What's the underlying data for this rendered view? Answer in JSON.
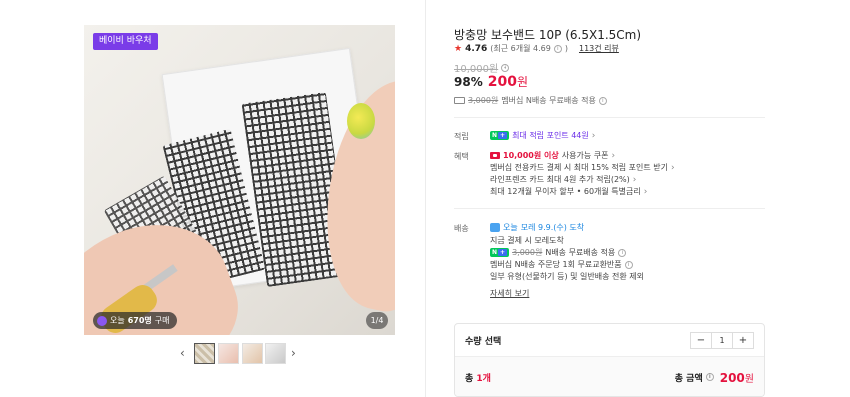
{
  "gallery": {
    "badge_top": "베이비 바우처",
    "badge_today_prefix": "오늘",
    "badge_today_count": "670명",
    "badge_today_suffix": "구매",
    "page_indicator": "1/4",
    "prev_icon": "chevron-left-icon",
    "next_icon": "chevron-right-icon",
    "thumbnail_count": 4
  },
  "product": {
    "title": "방충망 보수밴드 10P (6.5X1.5Cm)",
    "rating": "4.76",
    "rating_detail": "(최근 6개월 4.69",
    "review_link": "113건 리뷰",
    "original_price": "10,000원",
    "discount": "98%",
    "sale_price": "200",
    "currency": "원",
    "shipping_strike": "3,000원",
    "shipping_text": "멤버십 N배송 무료배송 적용"
  },
  "benefits": {
    "points_label": "적립",
    "points_text": "최대 적립 포인트 44원",
    "perks_label": "혜택",
    "perks": [
      {
        "highlight": "10,000원 이상",
        "text": "사용가능 쿠폰"
      },
      {
        "highlight": "",
        "text": "멤버십 전용카드 결제 시 최대 15% 적립 포인트 받기"
      },
      {
        "highlight": "",
        "text": "라인프렌즈 카드 최대 4원 추가 적립(2%)"
      },
      {
        "highlight": "",
        "text": "최대 12개월 무이자 할부 • 60개월 특별금리"
      }
    ]
  },
  "delivery": {
    "label": "배송",
    "chip_text": "오늘",
    "arrival": "모레 9.9.(수) 도착",
    "line2": "지금 결제 시 모레도착",
    "line3_strike": "3,000원",
    "line3_text": "N배송 무료배송 적용",
    "line4": "멤버십 N배송 주문당 1회 무료교환반품",
    "line5": "일부 유형(선물하기 등) 및 일반배송 전환 제외",
    "detail_link": "자세히 보기"
  },
  "quantity": {
    "label": "수량 선택",
    "minus": "−",
    "value": "1",
    "plus": "+",
    "total_count_prefix": "총",
    "total_count": "1개",
    "total_label": "총 금액",
    "total_price": "200",
    "currency": "원"
  },
  "colors": {
    "accent_red": "#e4123e",
    "npay_green": "#03c75a",
    "badge_purple": "#7a3ce8",
    "point_purple": "#6b2ee8"
  }
}
